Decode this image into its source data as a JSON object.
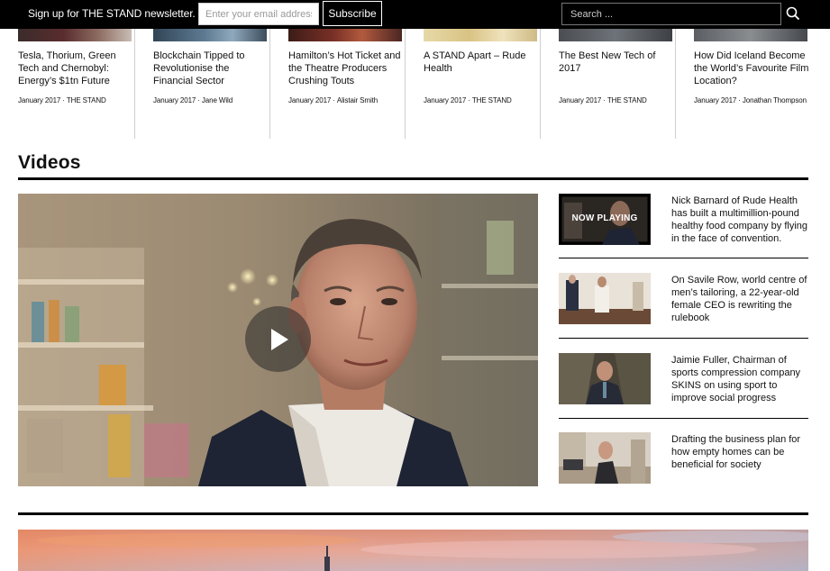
{
  "newsletter": {
    "label": "Sign up for THE STAND newsletter.",
    "email_placeholder": "Enter your email address",
    "email_value": "",
    "subscribe_label": "Subscribe"
  },
  "search": {
    "placeholder": "Search ...",
    "value": "",
    "icon": "search-icon"
  },
  "articles": [
    {
      "title": "Tesla, Thorium, Green Tech and Chernobyl: Energy’s $1tn Future",
      "date": "January 2017",
      "author": "THE STAND"
    },
    {
      "title": "Blockchain Tipped to Revolutionise the Financial Sector",
      "date": "January 2017",
      "author": "Jane Wild"
    },
    {
      "title": "Hamilton’s Hot Ticket and the Theatre Producers Crushing Touts",
      "date": "January 2017",
      "author": "Alistair Smith"
    },
    {
      "title": "A STAND Apart – Rude Health",
      "date": "January 2017",
      "author": "THE STAND"
    },
    {
      "title": "The Best New Tech of 2017",
      "date": "January 2017",
      "author": "THE STAND"
    },
    {
      "title": "How Did Iceland Become the World’s Favourite Film Location?",
      "date": "January 2017",
      "author": "Jonathan Thompson"
    }
  ],
  "meta_separator": "·",
  "videos": {
    "section_title": "Videos",
    "now_playing_label": "NOW PLAYING",
    "items": [
      {
        "title": "Nick Barnard of Rude Health has built a multimillion-pound healthy food company by flying in the face of convention."
      },
      {
        "title": "On Savile Row, world centre of men’s tailoring, a 22-year-old female CEO is rewriting the rulebook"
      },
      {
        "title": "Jaimie Fuller, Chairman of sports compression company SKINS on using sport to improve social progress"
      },
      {
        "title": "Drafting the business plan for how empty homes can be beneficial for society"
      }
    ]
  },
  "colors": {
    "top_bar": "#000000",
    "text": "#111111",
    "divider": "#cfcfcf"
  }
}
